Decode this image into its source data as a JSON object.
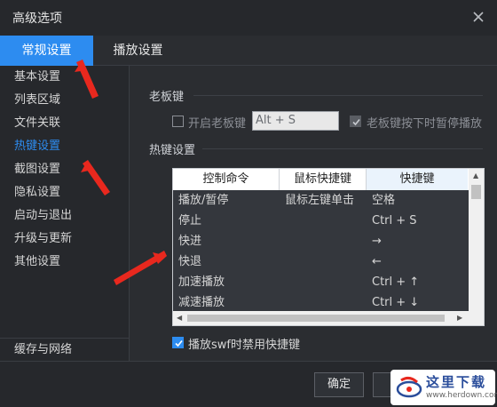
{
  "window": {
    "title": "高级选项"
  },
  "tabs": [
    {
      "label": "常规设置",
      "active": true
    },
    {
      "label": "播放设置",
      "active": false
    }
  ],
  "sidebar": {
    "items": [
      {
        "label": "基本设置"
      },
      {
        "label": "列表区域"
      },
      {
        "label": "文件关联"
      },
      {
        "label": "热键设置",
        "active": true
      },
      {
        "label": "截图设置"
      },
      {
        "label": "隐私设置"
      },
      {
        "label": "启动与退出"
      },
      {
        "label": "升级与更新"
      },
      {
        "label": "其他设置"
      }
    ],
    "bottom_item": "缓存与网络"
  },
  "boss_key": {
    "section_title": "老板键",
    "enable_label": "开启老板键",
    "enable_checked": false,
    "key_value": "Alt + S",
    "pause_label": "老板键按下时暂停播放",
    "pause_checked": true
  },
  "hotkeys": {
    "section_title": "热键设置",
    "columns": [
      "控制命令",
      "鼠标快捷键",
      "快捷键"
    ],
    "rows": [
      {
        "command": "播放/暂停",
        "mouse": "鼠标左键单击",
        "key": "空格"
      },
      {
        "command": "停止",
        "mouse": "",
        "key": "Ctrl + S"
      },
      {
        "command": "快进",
        "mouse": "",
        "key": "→"
      },
      {
        "command": "快退",
        "mouse": "",
        "key": "←"
      },
      {
        "command": "加速播放",
        "mouse": "",
        "key": "Ctrl + ↑"
      },
      {
        "command": "减速播放",
        "mouse": "",
        "key": "Ctrl + ↓"
      }
    ],
    "swf_label": "播放swf时禁用快捷键",
    "swf_checked": true
  },
  "footer": {
    "ok_label": "确定"
  },
  "watermark": {
    "text": "这里下载",
    "url": "www.herdown.com"
  },
  "colors": {
    "accent": "#2d8cf0",
    "annotation_arrow": "#e8281e",
    "background": "#2b2d31"
  }
}
